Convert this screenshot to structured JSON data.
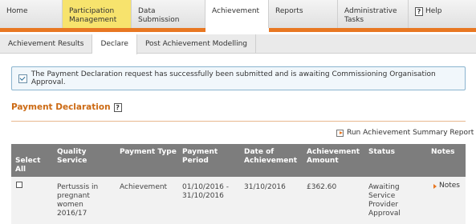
{
  "topnav": {
    "items": [
      {
        "label": "Home"
      },
      {
        "label": "Participation\nManagement"
      },
      {
        "label": "Data Submission"
      },
      {
        "label": "Achievement"
      },
      {
        "label": "Reports"
      },
      {
        "label": "Administrative\nTasks"
      },
      {
        "label": "Help"
      }
    ]
  },
  "subtabs": [
    {
      "label": "Achievement Results"
    },
    {
      "label": "Declare"
    },
    {
      "label": "Post Achievement Modelling"
    }
  ],
  "alert": {
    "message": "The Payment Declaration request has successfully been submitted and is awaiting Commissioning Organisation Approval."
  },
  "section": {
    "title": "Payment Declaration",
    "help_glyph": "?"
  },
  "run_report": {
    "label": "Run Achievement Summary Report"
  },
  "table": {
    "headers": {
      "select_all": "Select\nAll",
      "quality_service": "Quality\nService",
      "payment_type": "Payment Type",
      "payment_period": "Payment\nPeriod",
      "date_of_achievement": "Date of\nAchievement",
      "achievement_amount": "Achievement\nAmount",
      "status": "Status",
      "notes": "Notes"
    },
    "rows": [
      {
        "quality_service": "Pertussis in\npregnant\nwomen\n2016/17",
        "payment_type": "Achievement",
        "payment_period": "01/10/2016 -\n31/10/2016",
        "date_of_achievement": "31/10/2016",
        "achievement_amount": "£362.60",
        "status": "Awaiting\nService\nProvider\nApproval",
        "notes": "Notes"
      }
    ]
  },
  "colors": {
    "accent": "#e87722",
    "active_highlight": "#f7e36d",
    "title": "#cc6a14",
    "table_header": "#7d7d7d",
    "alert_border": "#8ab4cf"
  }
}
